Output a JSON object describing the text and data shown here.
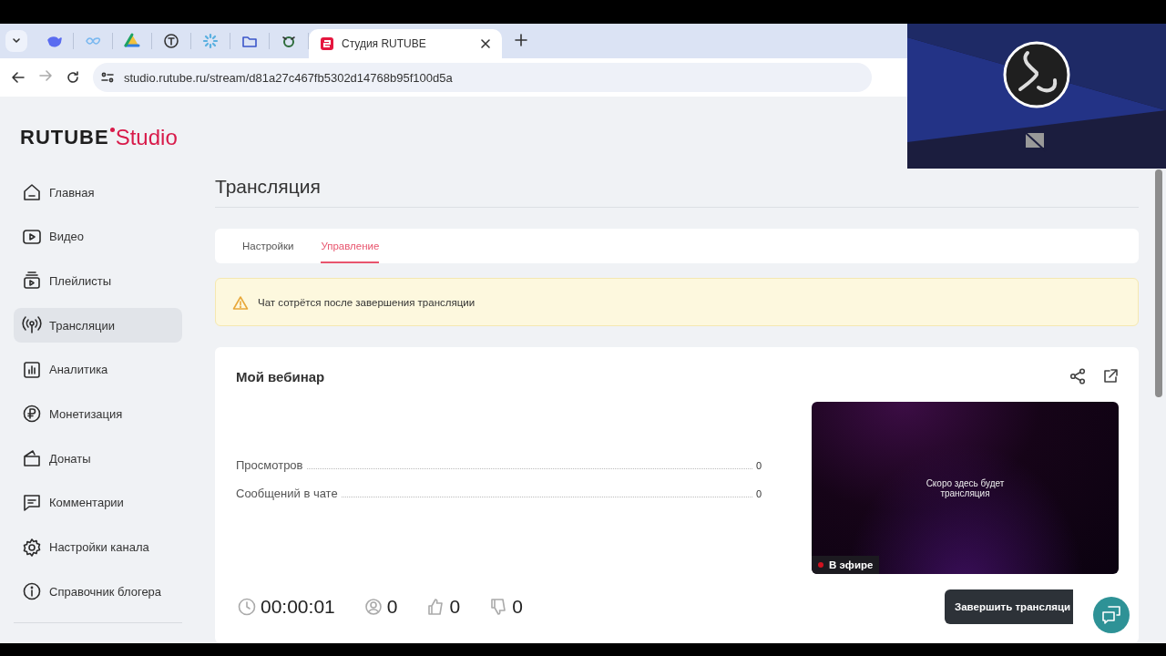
{
  "browser": {
    "tabs": [
      {
        "title": "Студия RUTUBE",
        "selected": true
      }
    ],
    "url": "studio.rutube.ru/stream/d81a27c467fb5302d14768b95f100d5a"
  },
  "logo": {
    "brand": "RUTUBE",
    "product": "Studio"
  },
  "sidebar": {
    "items": [
      {
        "label": "Главная",
        "selected": false
      },
      {
        "label": "Видео",
        "selected": false
      },
      {
        "label": "Плейлисты",
        "selected": false
      },
      {
        "label": "Трансляции",
        "selected": true
      },
      {
        "label": "Аналитика",
        "selected": false
      },
      {
        "label": "Монетизация",
        "selected": false
      },
      {
        "label": "Донаты",
        "selected": false
      },
      {
        "label": "Комментарии",
        "selected": false
      },
      {
        "label": "Настройки канала",
        "selected": false
      },
      {
        "label": "Справочник блогера",
        "selected": false
      }
    ]
  },
  "page": {
    "title": "Трансляция",
    "tabs": [
      {
        "label": "Настройки",
        "selected": false
      },
      {
        "label": "Управление",
        "selected": true
      }
    ],
    "alert": "Чат сотрётся после завершения трансляции"
  },
  "stream": {
    "title": "Мой вебинар",
    "stats": [
      {
        "label": "Просмотров",
        "value": "0"
      },
      {
        "label": "Сообщений в чате",
        "value": "0"
      }
    ],
    "preview": {
      "message": "Скоро здесь будет трансляция",
      "live_badge": "В эфире"
    },
    "counters": [
      {
        "kind": "duration",
        "value": "00:00:01"
      },
      {
        "kind": "viewers",
        "value": "0"
      },
      {
        "kind": "likes",
        "value": "0"
      },
      {
        "kind": "dislikes",
        "value": "0"
      }
    ],
    "end_button": "Завершить трансляци"
  }
}
